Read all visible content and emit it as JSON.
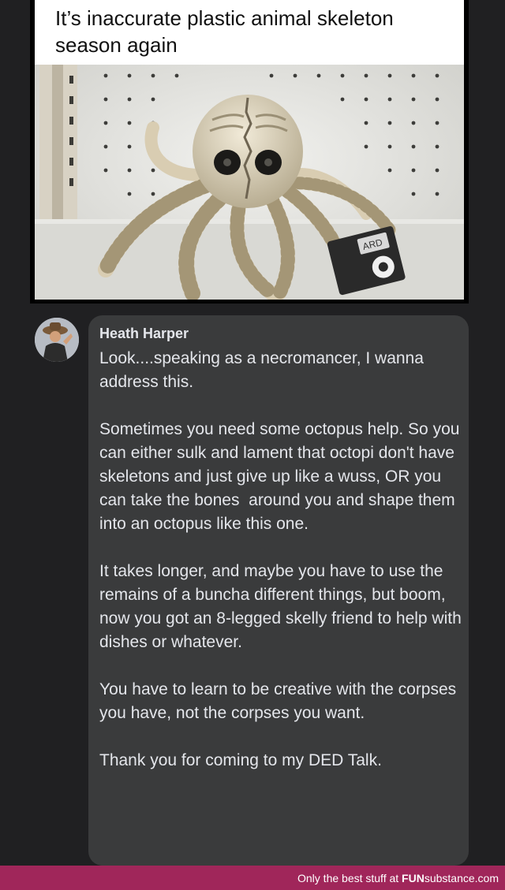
{
  "post": {
    "title": "It’s inaccurate plastic animal skeleton season again"
  },
  "photo": {
    "description_icon": "octopus-skeleton-photo",
    "tag_text": "ARD"
  },
  "comment": {
    "author": "Heath Harper",
    "paragraphs": [
      "Look....speaking as a necromancer, I wanna address this.",
      "Sometimes you need some octopus help. So you can either sulk and lament that octopi don't have skeletons and just give up like a wuss, OR you can take the bones  around you and shape them into an octopus like this one.",
      "It takes longer, and maybe you have to use the remains of a buncha different things, but boom, now you got an 8-legged skelly friend to help with dishes or whatever.",
      "You have to learn to be creative with the corpses you have, not the corpses you want.",
      "Thank you for coming to my DED Talk."
    ]
  },
  "footer": {
    "tagline": "Only the best stuff at ",
    "brand_fun": "FUN",
    "brand_rest": "substance.com"
  },
  "colors": {
    "background": "#202022",
    "bubble": "#3a3b3c",
    "text": "#e4e6eb",
    "footer": "#a0265a"
  }
}
